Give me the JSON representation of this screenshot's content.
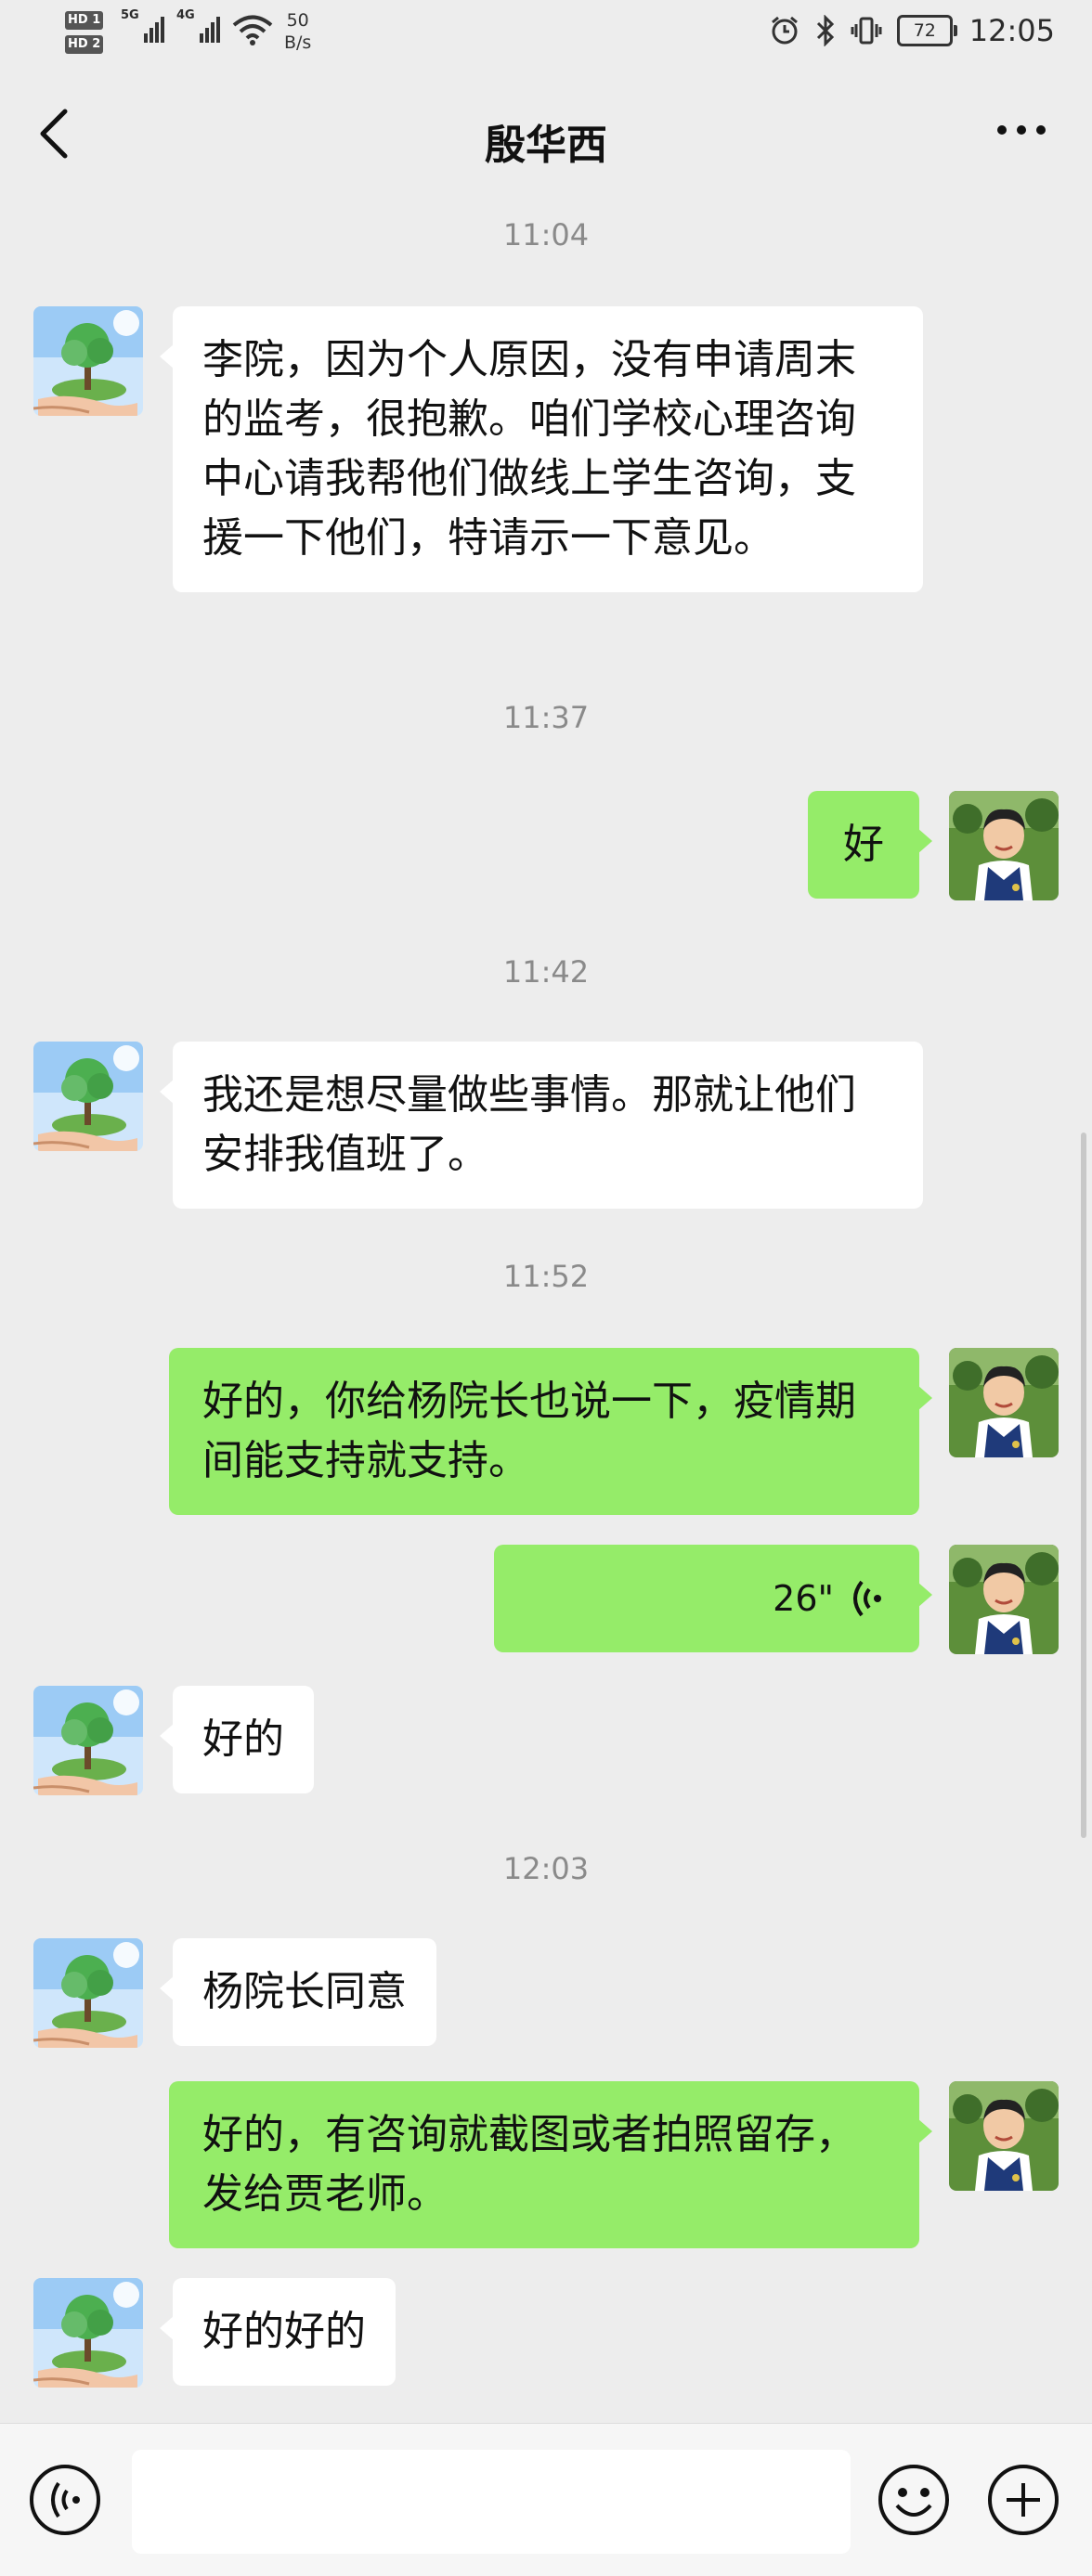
{
  "status_bar": {
    "hd1": "HD 1",
    "hd2": "HD 2",
    "net1": "5G",
    "net2": "4G",
    "speed_value": "50",
    "speed_unit": "B/s",
    "battery": "72",
    "time": "12:05",
    "icons": [
      "alarm-icon",
      "bluetooth-icon",
      "vibrate-icon"
    ]
  },
  "header": {
    "title": "殷华西"
  },
  "messages": {
    "t1": "11:04",
    "m1": "李院，因为个人原因，没有申请周末的监考，很抱歉。咱们学校心理咨询中心请我帮他们做线上学生咨询，支援一下他们，特请示一下意见。",
    "t2": "11:37",
    "m2": "好",
    "t3": "11:42",
    "m3": "我还是想尽量做些事情。那就让他们安排我值班了。",
    "t4": "11:52",
    "m4": "好的，你给杨院长也说一下，疫情期间能支持就支持。",
    "m5_voice": "26\"",
    "m6": "好的",
    "t5": "12:03",
    "m7": "杨院长同意",
    "m8": "好的，有咨询就截图或者拍照留存，发给贾老师。",
    "m9": "好的好的"
  },
  "input_bar": {
    "placeholder": ""
  },
  "colors": {
    "background": "#ededed",
    "incoming_bubble": "#ffffff",
    "outgoing_bubble": "#95ec69",
    "timestamp": "#8a8a8a"
  }
}
